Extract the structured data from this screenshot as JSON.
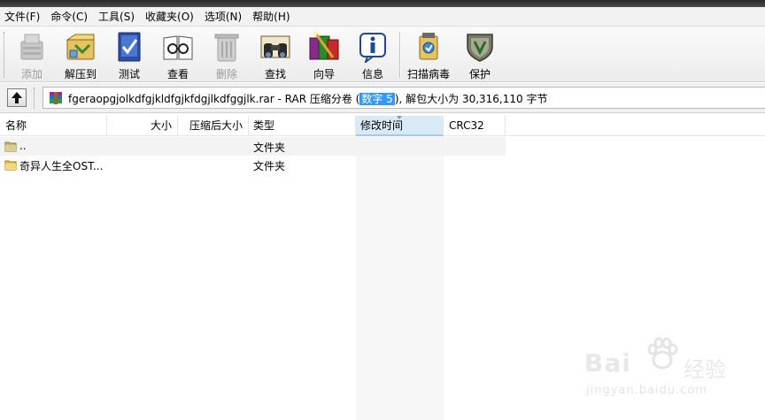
{
  "menubar": {
    "items": [
      "文件(F)",
      "命令(C)",
      "工具(S)",
      "收藏夹(O)",
      "选项(N)",
      "帮助(H)"
    ]
  },
  "toolbar": {
    "buttons": [
      {
        "label": "添加",
        "icon": "add-icon",
        "disabled": true
      },
      {
        "label": "解压到",
        "icon": "extract-to-icon",
        "disabled": false
      },
      {
        "label": "测试",
        "icon": "test-icon",
        "disabled": false
      },
      {
        "label": "查看",
        "icon": "view-icon",
        "disabled": false
      },
      {
        "label": "删除",
        "icon": "delete-icon",
        "disabled": true
      },
      {
        "label": "查找",
        "icon": "find-icon",
        "disabled": false
      },
      {
        "label": "向导",
        "icon": "wizard-icon",
        "disabled": false
      },
      {
        "label": "信息",
        "icon": "info-icon",
        "disabled": false
      },
      {
        "label": "扫描病毒",
        "icon": "virus-scan-icon",
        "disabled": false
      },
      {
        "label": "保护",
        "icon": "protect-icon",
        "disabled": false
      }
    ]
  },
  "address": {
    "archive_name": "fgeraopgjolkdfgjkldfgjkfdgjlkdfggjlk.rar",
    "archive_desc": " - RAR 压缩分卷 ",
    "open_paren": "(",
    "volume_highlight": "数字 5",
    "close_and_size": "), 解包大小为 30,316,110 字节",
    "archive_icon": "rar-archive-icon",
    "up_icon": "up-folder-icon"
  },
  "columns": {
    "name": "名称",
    "size": "大小",
    "packed": "压缩后大小",
    "type": "类型",
    "modified": "修改时间",
    "crc": "CRC32"
  },
  "files": [
    {
      "name": "..",
      "type": "文件夹",
      "icon": "parent-folder-icon"
    },
    {
      "name": "奇异人生全OST...",
      "type": "文件夹",
      "icon": "folder-icon"
    }
  ],
  "watermark": {
    "brand": "Bai",
    "brand_cn": "经验",
    "url": "jingyan.baidu.com"
  },
  "colors": {
    "highlight": "#3399ff",
    "sorted_header": "#d9eaf7",
    "folder": "#e8c25a"
  }
}
